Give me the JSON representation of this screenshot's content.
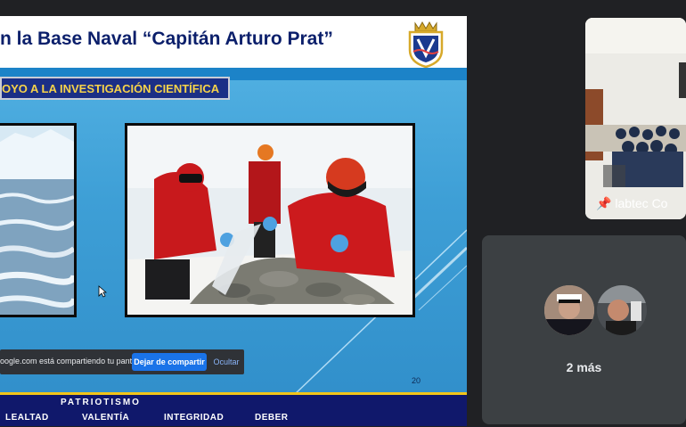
{
  "slide": {
    "title": "n la Base Naval “Capitán Arturo Prat”",
    "banner": "OYO A LA INVESTIGACIÓN CIENTÍFICA",
    "page_number": "20",
    "footer": {
      "top_value": "PATRIOTISMO",
      "values": [
        "LEALTAD",
        "VALENTÍA",
        "INTEGRIDAD",
        "DEBER"
      ]
    }
  },
  "share_bar": {
    "text": "oogle.com está compartiendo tu pantalla.",
    "stop_label": "Dejar de compartir",
    "hide_label": "Ocultar"
  },
  "participants": {
    "camera_tile_name": "labtec Co",
    "more_label": "2 más"
  },
  "colors": {
    "slide_title": "#0b1f6b",
    "banner_text": "#f7d34a",
    "footer_bg": "#10186b",
    "share_button": "#1a73e8"
  }
}
